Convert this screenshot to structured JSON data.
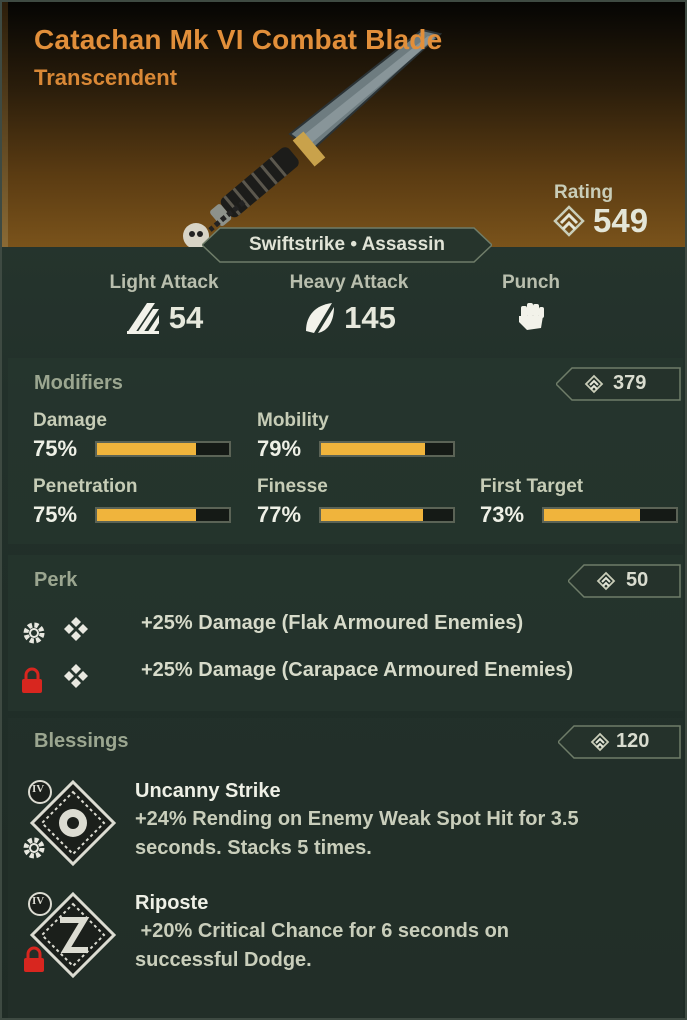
{
  "weapon": {
    "name": "Catachan Mk VI Combat Blade",
    "rarity": "Transcendent",
    "rating_label": "Rating",
    "rating_value": "549",
    "class_tags": "Swiftstrike • Assassin"
  },
  "attacks": [
    {
      "label": "Light Attack",
      "value": "54",
      "icon": "light-attack-icon"
    },
    {
      "label": "Heavy Attack",
      "value": "145",
      "icon": "heavy-attack-icon"
    },
    {
      "label": "Punch",
      "value": "",
      "icon": "fist-icon"
    }
  ],
  "modifiers": {
    "title": "Modifiers",
    "score": "379",
    "items": [
      {
        "label": "Damage",
        "percent": "75%",
        "fill": 0.75
      },
      {
        "label": "Mobility",
        "percent": "79%",
        "fill": 0.79
      },
      {
        "label": "Penetration",
        "percent": "75%",
        "fill": 0.75
      },
      {
        "label": "Finesse",
        "percent": "77%",
        "fill": 0.77
      },
      {
        "label": "First Target",
        "percent": "73%",
        "fill": 0.73
      }
    ]
  },
  "perk": {
    "title": "Perk",
    "score": "50",
    "items": [
      {
        "text": "+25% Damage (Flak Armoured Enemies)",
        "status_icon": "gear-icon"
      },
      {
        "text": "+25% Damage (Carapace Armoured Enemies)",
        "status_icon": "lock-icon"
      }
    ]
  },
  "blessings": {
    "title": "Blessings",
    "score": "120",
    "items": [
      {
        "tier": "IV",
        "name": "Uncanny Strike",
        "desc_line1": "+24% Rending on Enemy Weak Spot Hit for 3.5",
        "desc_line2": "seconds. Stacks 5 times.",
        "status_icon": "gear-icon"
      },
      {
        "tier": "IV",
        "name": "Riposte",
        "desc_line1": " +20% Critical Chance for 6 seconds on",
        "desc_line2": "successful Dodge.",
        "status_icon": "lock-icon"
      }
    ]
  },
  "colors": {
    "accent_orange": "#e28f3a",
    "bar_fill": "#f0b43c",
    "lock_red": "#d8261f"
  }
}
